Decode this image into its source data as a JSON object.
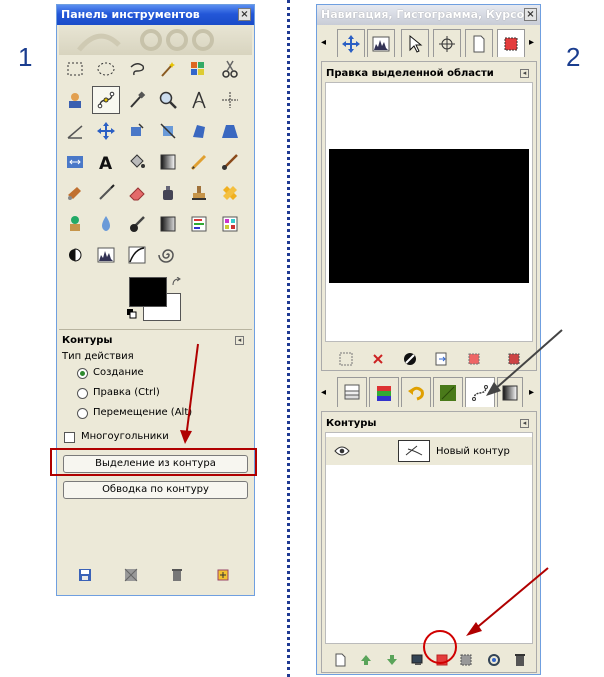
{
  "labels": {
    "one": "1",
    "two": "2"
  },
  "toolbox": {
    "title": "Панель инструментов",
    "close": "×",
    "paths_header": "Контуры",
    "action_type": "Тип действия",
    "mode_create": "Создание",
    "mode_edit": "Правка (Ctrl)",
    "mode_move": "Перемещение (Alt)",
    "polygonal": "Многоугольники",
    "selection_from_path": "Выделение из контура",
    "stroke_path": "Обводка по контуру"
  },
  "dock": {
    "title": "Навигация, Гистограмма, Курсор",
    "close": "×",
    "selection_editor_header": "Правка выделенной области",
    "paths_header": "Контуры",
    "path_name": "Новый контур"
  },
  "colors": {
    "titlebar": "#2357d8",
    "panel": "#ece9d8",
    "annotation_red": "#b00000",
    "separator": "#1f3a93"
  }
}
